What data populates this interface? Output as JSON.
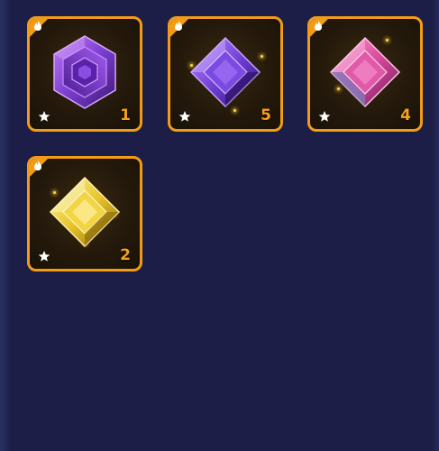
{
  "inventory": {
    "slots": [
      {
        "name": "purple-hexagon-gem",
        "count": "1",
        "icon": "flame-icon",
        "gem_color": "#7b3fd0"
      },
      {
        "name": "violet-diamond-gem",
        "count": "5",
        "icon": "flame-icon",
        "gem_color": "#7a46d6"
      },
      {
        "name": "pink-diamond-gem",
        "count": "4",
        "icon": "flame-icon",
        "gem_color": "#d9499c"
      },
      {
        "name": "yellow-diamond-gem",
        "count": "2",
        "icon": "flame-icon",
        "gem_color": "#e7c52a"
      }
    ]
  },
  "colors": {
    "background": "#1c1e47",
    "slot_border": "#f29b17",
    "count_text": "#f5a11a"
  }
}
